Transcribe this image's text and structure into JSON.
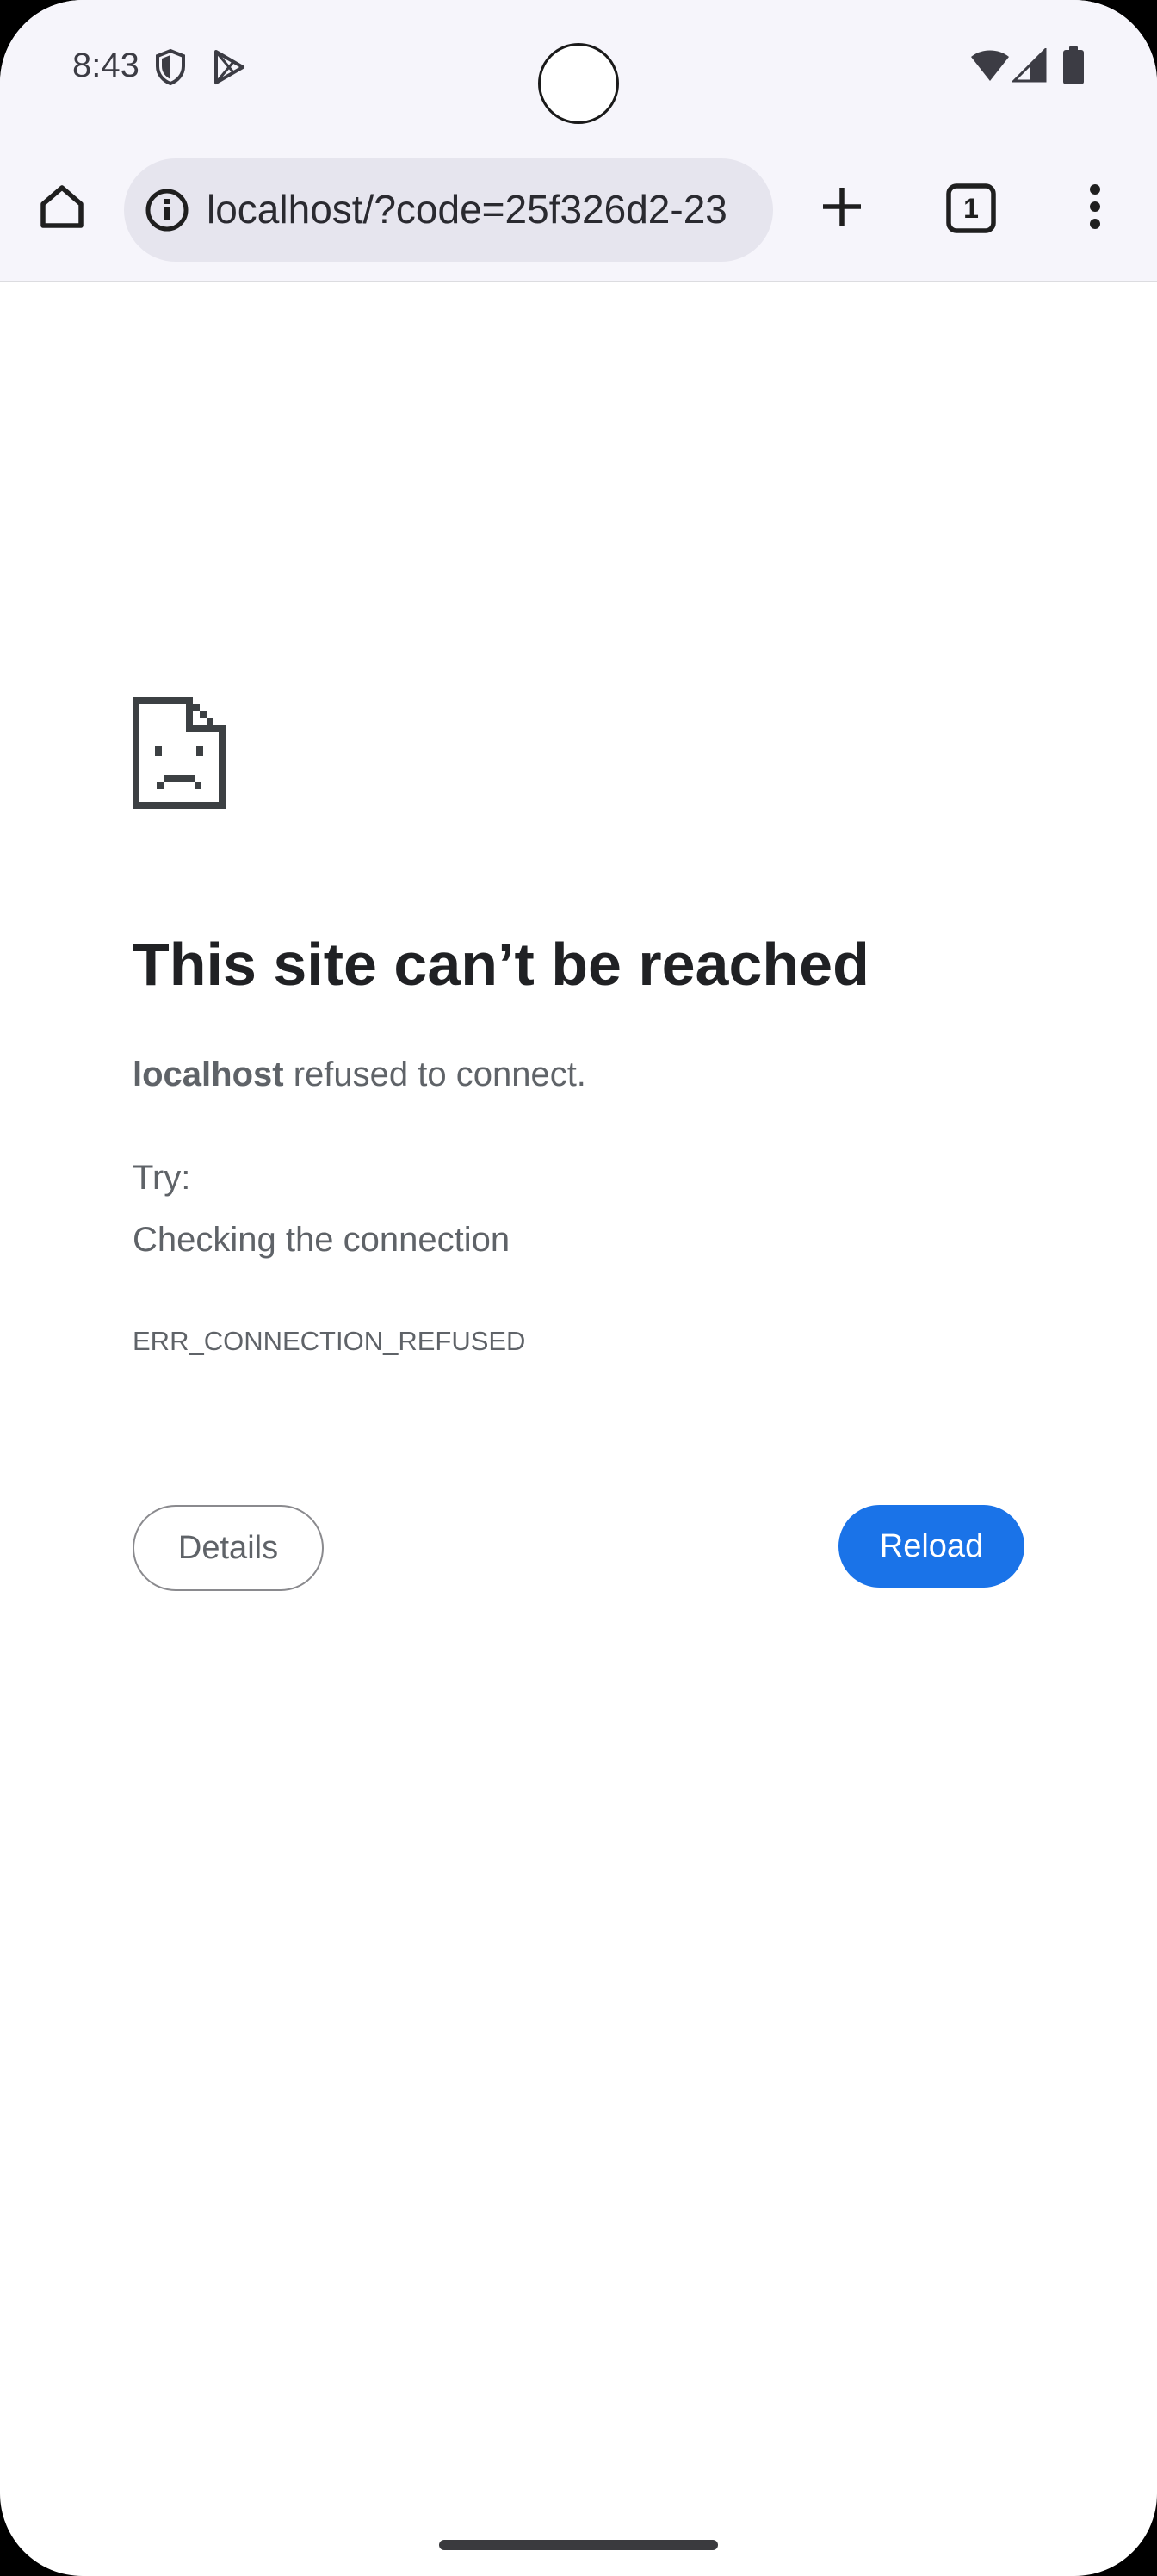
{
  "status_bar": {
    "time": "8:43",
    "icons": [
      "shield-icon",
      "play-store-icon",
      "wifi-icon",
      "signal-icon",
      "battery-icon"
    ]
  },
  "toolbar": {
    "home_icon": "home-icon",
    "url": "localhost/?code=25f326d2-23",
    "info_icon": "info-icon",
    "new_tab_icon": "plus-icon",
    "tab_count": "1",
    "menu_icon": "more-vert-icon"
  },
  "error_page": {
    "icon": "sad-document-icon",
    "title": "This site can’t be reached",
    "host": "localhost",
    "message": " refused to connect.",
    "try_label": "Try:",
    "suggestion": "Checking the connection",
    "error_code": "ERR_CONNECTION_REFUSED",
    "details_label": "Details",
    "reload_label": "Reload"
  },
  "colors": {
    "accent": "#1a73e8",
    "chrome_bg": "#f6f5fb",
    "url_bar_bg": "#e6e5ee",
    "title_text": "#202124",
    "body_text": "#5f6368"
  }
}
